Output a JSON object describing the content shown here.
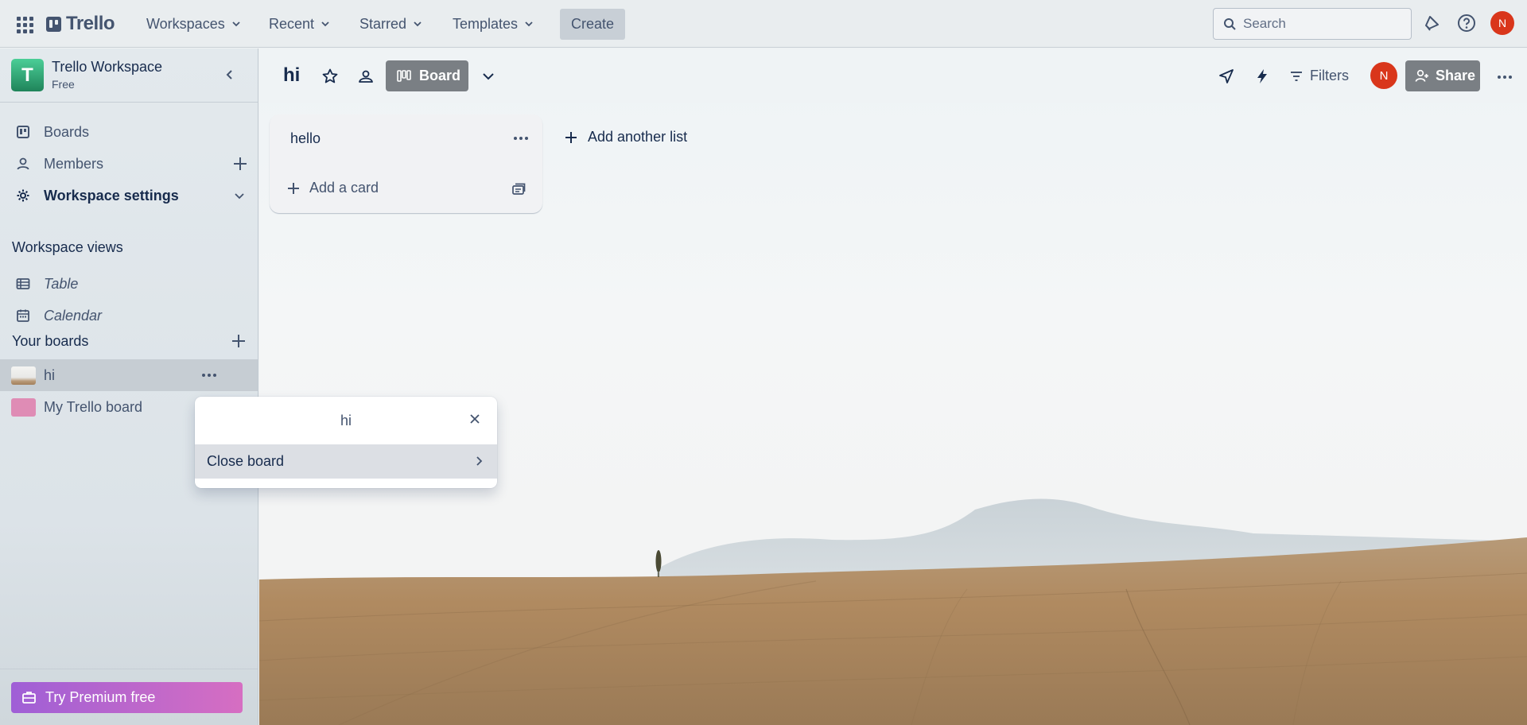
{
  "topnav": {
    "logo_text": "Trello",
    "menus": [
      {
        "label": "Workspaces"
      },
      {
        "label": "Recent"
      },
      {
        "label": "Starred"
      },
      {
        "label": "Templates"
      }
    ],
    "create_label": "Create",
    "search_placeholder": "Search",
    "avatar_initial": "N"
  },
  "sidebar": {
    "workspace_initial": "T",
    "workspace_name": "Trello Workspace",
    "workspace_plan": "Free",
    "items": [
      {
        "label": "Boards"
      },
      {
        "label": "Members"
      },
      {
        "label": "Workspace settings"
      }
    ],
    "views_heading": "Workspace views",
    "views": [
      {
        "label": "Table"
      },
      {
        "label": "Calendar"
      }
    ],
    "boards_heading": "Your boards",
    "boards": [
      {
        "label": "hi"
      },
      {
        "label": "My Trello board"
      }
    ],
    "premium_label": "Try Premium free"
  },
  "board": {
    "title": "hi",
    "view_label": "Board",
    "filters_label": "Filters",
    "avatar_initial": "N",
    "share_label": "Share",
    "lists": [
      {
        "title": "hello",
        "add_card_label": "Add a card"
      }
    ],
    "add_list_label": "Add another list"
  },
  "popover": {
    "title": "hi",
    "item_label": "Close board"
  },
  "colors": {
    "accent": "#0c66e4",
    "avatar": "#d9361b",
    "workspace_badge": "#1f845a",
    "premium_start": "#9f5fd6",
    "premium_end": "#d66ec2",
    "board_thumb_pink": "#df8cb5"
  }
}
